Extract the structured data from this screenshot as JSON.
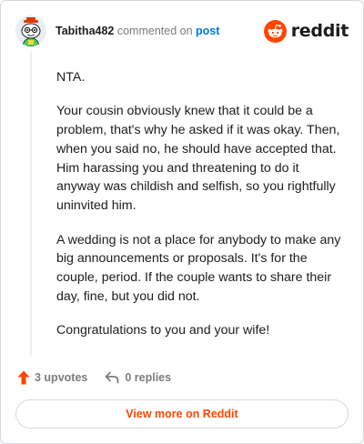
{
  "header": {
    "username": "Tabitha482",
    "action_text": "commented on",
    "post_link": "post",
    "brand": "reddit"
  },
  "comment": {
    "paragraphs": [
      "NTA.",
      "Your cousin obviously knew that it could be a problem, that's why he asked if it was okay. Then, when you said no, he should have accepted that. Him harassing you and threatening to do it anyway was childish and selfish, so you rightfully uninvited him.",
      "A wedding is not a place for anybody to make any big announcements or proposals. It's for the couple, period. If the couple wants to share their day, fine, but you did not.",
      "Congratulations to you and your wife!"
    ]
  },
  "actions": {
    "upvotes": "3 upvotes",
    "replies": "0 replies"
  },
  "footer": {
    "view_more": "View more on Reddit"
  },
  "colors": {
    "accent": "#ff4500",
    "link": "#0079d3",
    "muted": "#7c7c7c"
  },
  "icons": [
    "avatar-icon",
    "reddit-logo-icon",
    "upvote-arrow-icon",
    "reply-arrow-icon"
  ]
}
